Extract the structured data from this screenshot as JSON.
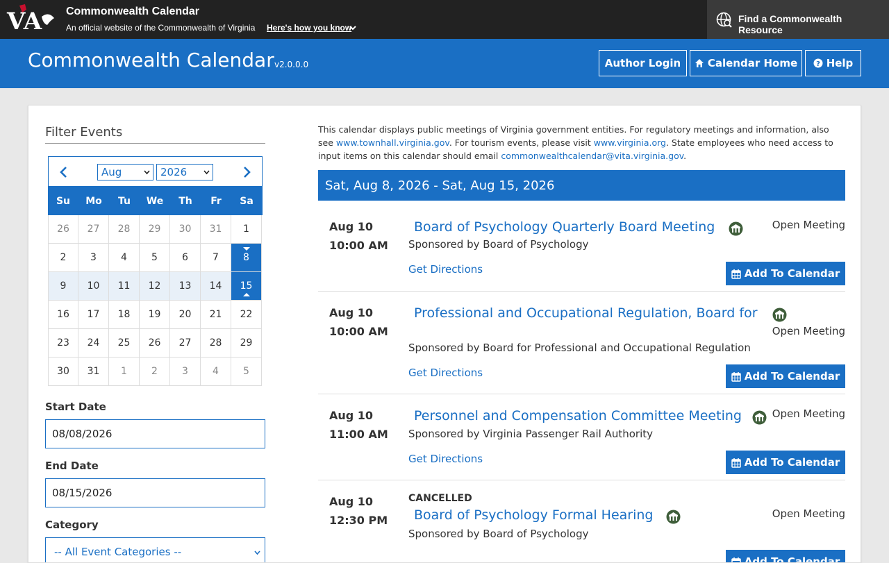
{
  "topbar": {
    "logo_text": "VA",
    "site_title": "Commonwealth Calendar",
    "site_subtitle": "An official website of the Commonwealth of Virginia",
    "how_you_know": "Here's how you know",
    "find_resource": "Find a Commonwealth Resource"
  },
  "header": {
    "title": "Commonwealth Calendar",
    "version": "v2.0.0.0",
    "buttons": {
      "author_login": "Author Login",
      "calendar_home": "Calendar Home",
      "help": "Help"
    }
  },
  "filter": {
    "title": "Filter Events",
    "calendar": {
      "month": "Aug",
      "year": "2026",
      "weekdays": [
        "Su",
        "Mo",
        "Tu",
        "We",
        "Th",
        "Fr",
        "Sa"
      ],
      "days": [
        [
          "26",
          "27",
          "28",
          "29",
          "30",
          "31",
          "1"
        ],
        [
          "2",
          "3",
          "4",
          "5",
          "6",
          "7",
          "8"
        ],
        [
          "9",
          "10",
          "11",
          "12",
          "13",
          "14",
          "15"
        ],
        [
          "16",
          "17",
          "18",
          "19",
          "20",
          "21",
          "22"
        ],
        [
          "23",
          "24",
          "25",
          "26",
          "27",
          "28",
          "29"
        ],
        [
          "30",
          "31",
          "1",
          "2",
          "3",
          "4",
          "5"
        ]
      ],
      "selected_start": "8",
      "selected_end": "15"
    },
    "start_date_label": "Start Date",
    "start_date_value": "08/08/2026",
    "end_date_label": "End Date",
    "end_date_value": "08/15/2026",
    "category_label": "Category",
    "category_value": "-- All Event Categories --"
  },
  "intro": {
    "text1": "This calendar displays public meetings of Virginia government entities. For regulatory meetings and information, also see ",
    "link1": "www.townhall.virginia.gov",
    "text2": ". For tourism events, please visit ",
    "link2": "www.virginia.org",
    "text3": ". State employees who need access to input items on this calendar should email ",
    "link3": "commonwealthcalendar@vita.virginia.gov",
    "text4": "."
  },
  "date_range": "Sat, Aug 8, 2026 - Sat, Aug 15, 2026",
  "events": [
    {
      "date": "Aug 10",
      "time": "10:00 AM",
      "status": "",
      "title": "Board of Psychology Quarterly Board Meeting",
      "type": "Open Meeting",
      "sponsor": "Sponsored by Board of Psychology",
      "directions": "Get Directions",
      "add": "Add To Calendar"
    },
    {
      "date": "Aug 10",
      "time": "10:00 AM",
      "status": "",
      "title": "Professional and Occupational Regulation, Board for",
      "type": "Open Meeting",
      "sponsor": "Sponsored by Board for Professional and Occupational Regulation",
      "directions": "Get Directions",
      "add": "Add To Calendar"
    },
    {
      "date": "Aug 10",
      "time": "11:00 AM",
      "status": "",
      "title": "Personnel and Compensation Committee Meeting",
      "type": "Open Meeting",
      "sponsor": "Sponsored by Virginia Passenger Rail Authority",
      "directions": "Get Directions",
      "add": "Add To Calendar"
    },
    {
      "date": "Aug 10",
      "time": "12:30 PM",
      "status": "CANCELLED",
      "title": "Board of Psychology Formal Hearing",
      "type": "Open Meeting",
      "sponsor": "Sponsored by Board of Psychology",
      "directions": "",
      "add": "Add To Calendar"
    }
  ],
  "colors": {
    "brand_blue": "#1a6fc4",
    "topbar": "#222222",
    "range_bg": "#e8f0f8"
  }
}
